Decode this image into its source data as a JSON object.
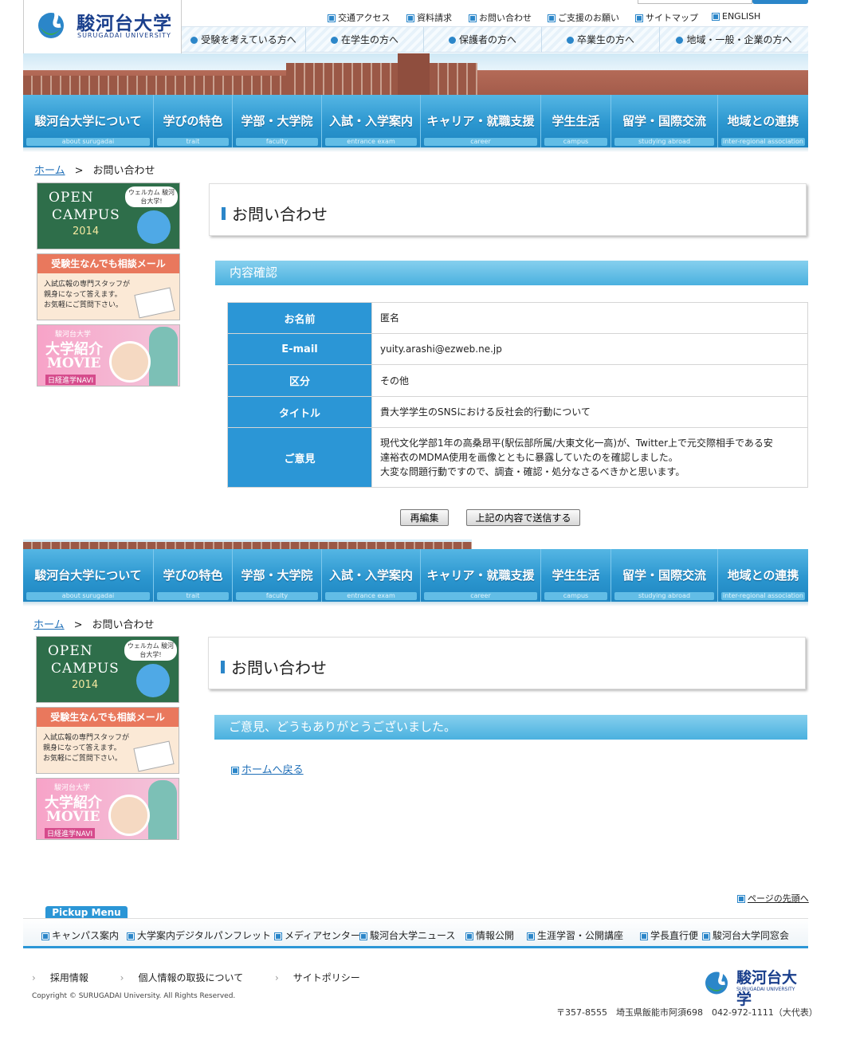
{
  "header": {
    "logo_jp": "駿河台大学",
    "logo_en": "SURUGADAI UNIVERSITY",
    "utility_links": [
      "交通アクセス",
      "資料請求",
      "お問い合わせ",
      "ご支援のお願い",
      "サイトマップ",
      "ENGLISH"
    ],
    "audience_links": [
      "受験を考えている方へ",
      "在学生の方へ",
      "保護者の方へ",
      "卒業生の方へ",
      "地域・一般・企業の方へ"
    ]
  },
  "gnav": [
    {
      "jp": "駿河台大学について",
      "en": "about surugadai"
    },
    {
      "jp": "学びの特色",
      "en": "trait"
    },
    {
      "jp": "学部・大学院",
      "en": "faculty"
    },
    {
      "jp": "入試・入学案内",
      "en": "entrance exam"
    },
    {
      "jp": "キャリア・就職支援",
      "en": "career"
    },
    {
      "jp": "学生生活",
      "en": "campus"
    },
    {
      "jp": "留学・国際交流",
      "en": "studying abroad"
    },
    {
      "jp": "地域との連携",
      "en": "inter-regional association"
    }
  ],
  "breadcrumb": {
    "home": "ホーム",
    "sep": ">",
    "current": "お問い合わせ"
  },
  "side_banners": {
    "open_campus": {
      "line1": "OPEN",
      "line2": "CAMPUS",
      "year": "2014",
      "bubble": "ウェルカム 駿河台大学!"
    },
    "mail": {
      "title": "受験生なんでも相談メール",
      "body1": "入試広報の専門スタッフが",
      "body2": "親身になって答えます。",
      "body3": "お気軽にご質問下さい。"
    },
    "movie": {
      "line1": "駿河台大学",
      "line2": "大学紹介",
      "line3": "MOVIE",
      "line4": "日経進学NAVI"
    }
  },
  "confirm": {
    "page_title": "お問い合わせ",
    "section": "内容確認",
    "rows": [
      {
        "label": "お名前",
        "value": "匿名"
      },
      {
        "label": "E-mail",
        "value": "yuity.arashi@ezweb.ne.jp"
      },
      {
        "label": "区分",
        "value": "その他"
      },
      {
        "label": "タイトル",
        "value": "貴大学学生のSNSにおける反社会的行動について"
      },
      {
        "label": "ご意見",
        "value1": "現代文化学部1年の高桑昂平(駅伝部所属/大東文化一高)が、Twitter上で元交際相手である安",
        "value2": "達裕衣のMDMA使用を画像とともに暴露していたのを確認しました。",
        "value3": "大変な問題行動ですので、調査・確認・処分なさるべきかと思います。"
      }
    ],
    "btn_edit": "再編集",
    "btn_send": "上記の内容で送信する"
  },
  "thanks": {
    "page_title": "お問い合わせ",
    "section": "ご意見、どうもありがとうございました。",
    "home_link": "ホームへ戻る"
  },
  "footer": {
    "page_top": "ページの先頭へ",
    "pickup_title": "Pickup Menu",
    "pickup": [
      "キャンパス案内",
      "大学案内デジタルパンフレット",
      "メディアセンター",
      "駿河台大学ニュース",
      "情報公開",
      "生涯学習・公開講座",
      "学長直行便",
      "駿河台大学同窓会"
    ],
    "links": [
      "採用情報",
      "個人情報の取扱について",
      "サイトポリシー"
    ],
    "copyright": "Copyright © SURUGADAI University. All Rights Reserved.",
    "address": "〒357-8555　埼玉県飯能市阿須698　042-972-1111（大代表）",
    "logo_jp": "駿河台大学",
    "logo_en": "SURUGADAI UNIVERSITY"
  },
  "colors": {
    "accent": "#2b96d6",
    "link": "#1f6fb8",
    "section": "#4ab1df"
  }
}
